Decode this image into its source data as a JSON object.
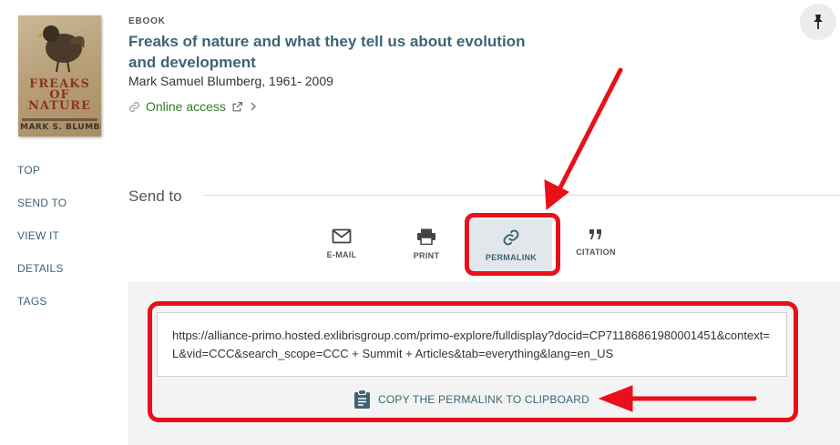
{
  "record": {
    "type_label": "EBOOK",
    "title": "Freaks of nature and what they tell us about evolution and development",
    "author": "Mark Samuel Blumberg, 1961- 2009",
    "online_access_label": "Online access",
    "cover": {
      "title_text": "FREAKS OF NATURE",
      "author_text": "MARK S. BLUMBERG"
    }
  },
  "side_nav": {
    "items": [
      {
        "label": "TOP"
      },
      {
        "label": "SEND TO"
      },
      {
        "label": "VIEW IT"
      },
      {
        "label": "DETAILS"
      },
      {
        "label": "TAGS"
      }
    ]
  },
  "send_to": {
    "title": "Send to",
    "actions": [
      {
        "label": "E-MAIL",
        "icon": "envelope-icon",
        "active": false
      },
      {
        "label": "PRINT",
        "icon": "printer-icon",
        "active": false
      },
      {
        "label": "PERMALINK",
        "icon": "link-icon",
        "active": true
      },
      {
        "label": "CITATION",
        "icon": "quote-icon",
        "active": false
      }
    ]
  },
  "permalink": {
    "url": "https://alliance-primo.hosted.exlibrisgroup.com/primo-explore/fulldisplay?docid=CP71186861980001451&context=L&vid=CCC&search_scope=CCC + Summit + Articles&tab=everything&lang=en_US",
    "copy_label": "COPY THE PERMALINK TO CLIPBOARD"
  },
  "colors": {
    "link": "#3d6474",
    "online": "#2e7d22",
    "annotation": "#e8101a",
    "active_bg": "#e2e7ec",
    "panel_bg": "#f3f3f3"
  }
}
